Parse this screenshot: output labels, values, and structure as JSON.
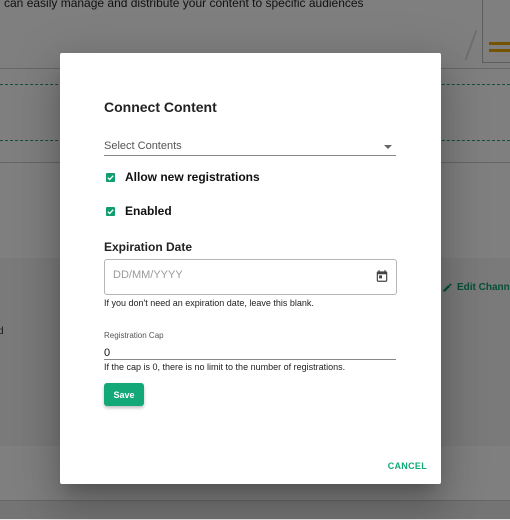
{
  "background": {
    "intro_text": "u can easily manage and distribute your content to specific audiences",
    "side_letter": "d",
    "edit_channel_label": "Edit Channel"
  },
  "dialog": {
    "title": "Connect Content",
    "select": {
      "placeholder": "Select Contents"
    },
    "checkboxes": [
      {
        "label": "Allow new registrations",
        "checked": true
      },
      {
        "label": "Enabled",
        "checked": true
      }
    ],
    "expiration": {
      "label": "Expiration Date",
      "placeholder": "DD/MM/YYYY",
      "helper": "If you don't need an expiration date, leave this blank."
    },
    "registration_cap": {
      "label": "Registration Cap",
      "value": "0",
      "helper": "If the cap is 0, there is no limit to the number of registrations."
    },
    "save_label": "Save",
    "cancel_label": "CANCEL"
  },
  "colors": {
    "accent": "#12a878",
    "overlay": "rgba(0,0,0,0.5)"
  },
  "icons": {
    "select_arrow": "caret-down-icon",
    "checkbox": "check-icon",
    "calendar": "calendar-icon",
    "edit": "pencil-icon"
  }
}
